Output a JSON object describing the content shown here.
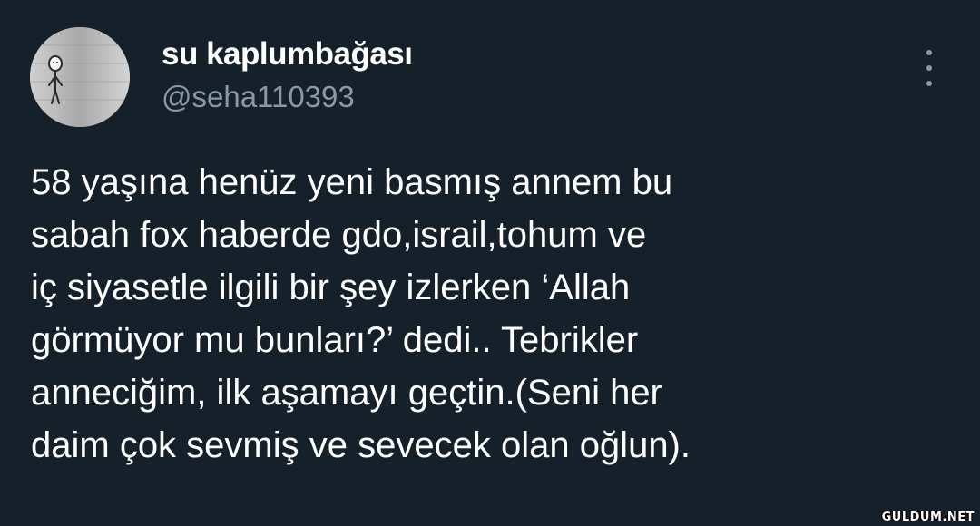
{
  "tweet": {
    "author_name": "su kaplumbağası",
    "author_handle": "@seha110393",
    "text_lines": [
      "58 yaşına henüz yeni basmış annem bu",
      "sabah fox haberde gdo,israil,tohum ve",
      "iç siyasetle ilgili bir şey izlerken ‘Allah",
      "görmüyor mu bunları?’ dedi.. Tebrikler",
      "anneciğim, ilk aşamayı geçtin.(Seni her",
      "daim çok sevmiş ve sevecek olan oğlun)."
    ]
  },
  "watermark": "GULDUM.NET",
  "icons": {
    "avatar": "stick-figure-avatar-icon",
    "more": "more-vertical-icon"
  },
  "colors": {
    "background": "#15202b",
    "text": "#ffffff",
    "secondary_text": "#8b98a5"
  }
}
